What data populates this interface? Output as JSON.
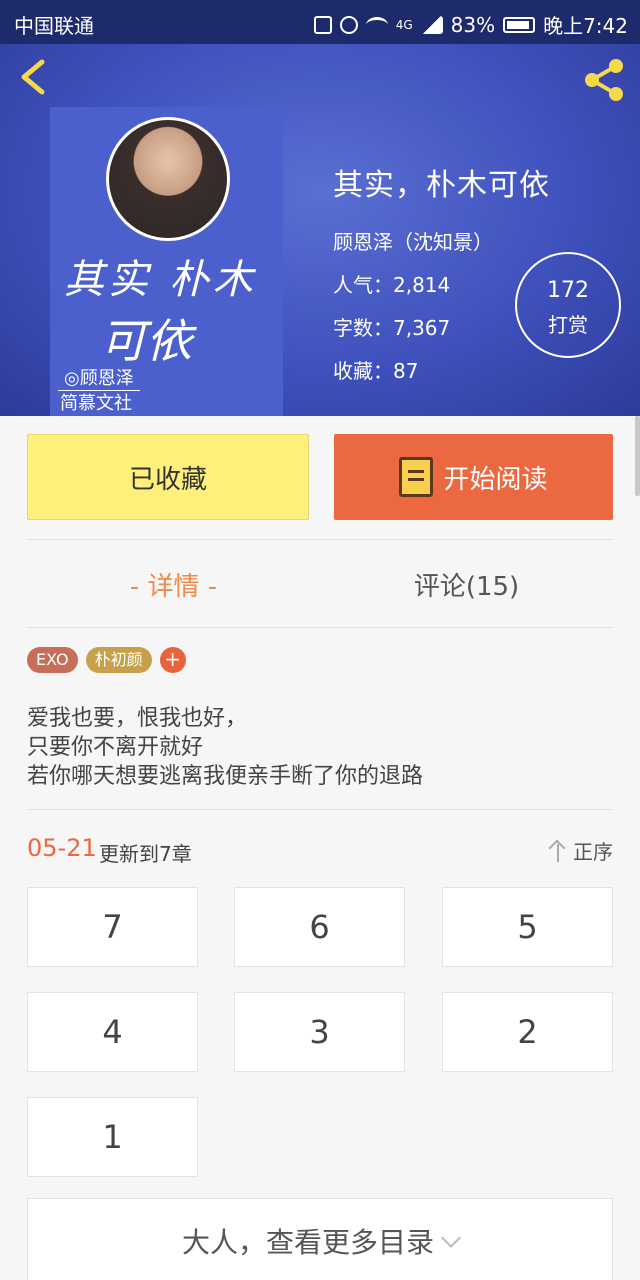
{
  "status_bar": {
    "carrier": "中国联通",
    "network": "4G",
    "battery": "83%",
    "time": "晚上7:42"
  },
  "colors": {
    "header_bg": "#3f51bd",
    "accent": "#ec6840",
    "favorite_bg": "#fef07a",
    "tab_active": "#f08a4b"
  },
  "book": {
    "title": "其实，朴木可依",
    "author": "顾恩泽（沈知景）",
    "popularity": "人气：2,814",
    "word_count": "字数：7,367",
    "favorites": "收藏：87"
  },
  "cover": {
    "title_line1": "其实 朴木",
    "title_line2": "可依",
    "author": "◎顾恩泽",
    "publisher": "简慕文社"
  },
  "tip": {
    "count": "172",
    "label": "打赏"
  },
  "actions": {
    "favorite_label": "已收藏",
    "read_label": "开始阅读"
  },
  "tabs": {
    "detail": "- 详情 -",
    "comments": "评论(15)"
  },
  "tags": [
    "EXO",
    "朴初颜"
  ],
  "tag_add": "+",
  "description": [
    "爱我也要，恨我也好，",
    "只要你不离开就好",
    "若你哪天想要逃离我便亲手断了你的退路"
  ],
  "update": {
    "date": "05-21",
    "text": "更新到7章",
    "sort_label": "正序"
  },
  "chapters": [
    "7",
    "6",
    "5",
    "4",
    "3",
    "2",
    "1"
  ],
  "more_label": "大人，查看更多目录"
}
